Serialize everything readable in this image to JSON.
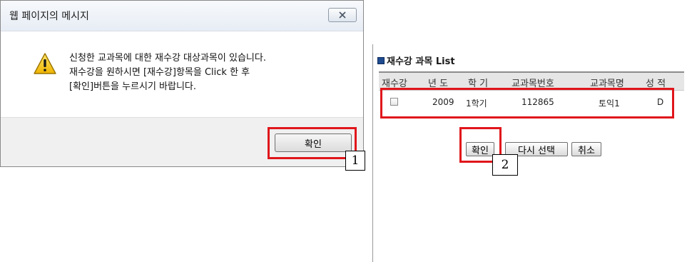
{
  "dialog": {
    "title": "웹 페이지의 메시지",
    "message_lines": [
      "신청한 교과목에 대한 재수강 대상과목이 있습니다.",
      "재수강을 원하시면 [재수강]항목을  Click  한 후",
      "[확인]버튼을 누르시기 바랍니다."
    ],
    "ok_label": "확인",
    "close_icon": "close-icon",
    "warning_icon": "warning-icon"
  },
  "panel": {
    "title": "재수강 과목 List",
    "columns": [
      "재수강",
      "년 도",
      "학 기",
      "교과목번호",
      "교과목명",
      "성 적"
    ],
    "rows": [
      {
        "year": "2009",
        "semester": "1학기",
        "course_code": "112865",
        "course_name": "토익1",
        "grade": "D"
      }
    ],
    "buttons": {
      "ok": "확인",
      "reselect": "다시 선택",
      "cancel": "취소"
    }
  },
  "annotations": {
    "step1": "1",
    "step2": "2"
  },
  "colors": {
    "highlight": "#e0161b",
    "bullet": "#1f4b8f"
  }
}
